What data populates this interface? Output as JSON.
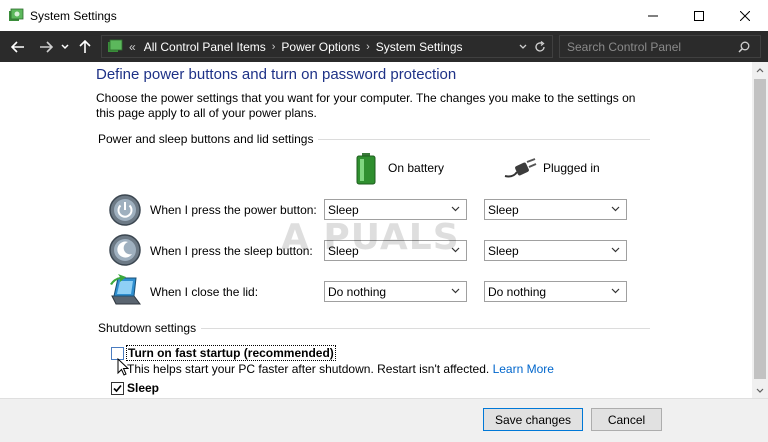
{
  "window": {
    "title": "System Settings",
    "minimize_icon": "minimize-icon",
    "maximize_icon": "maximize-icon",
    "close_icon": "close-icon"
  },
  "address": {
    "overflow": "«",
    "crumbs": [
      "All Control Panel Items",
      "Power Options",
      "System Settings"
    ],
    "search_placeholder": "Search Control Panel"
  },
  "page": {
    "heading": "Define power buttons and turn on password protection",
    "description": "Choose the power settings that you want for your computer. The changes you make to the settings on this page apply to all of your power plans.",
    "group1_label": "Power and sleep buttons and lid settings",
    "col_battery": "On battery",
    "col_plugged": "Plugged in",
    "rows": [
      {
        "label": "When I press the power button:",
        "battery": "Sleep",
        "plugged": "Sleep"
      },
      {
        "label": "When I press the sleep button:",
        "battery": "Sleep",
        "plugged": "Sleep"
      },
      {
        "label": "When I close the lid:",
        "battery": "Do nothing",
        "plugged": "Do nothing"
      }
    ],
    "group2_label": "Shutdown settings",
    "fast_startup_label": "Turn on fast startup (recommended)",
    "fast_startup_checked": false,
    "fast_startup_hint": "This helps start your PC faster after shutdown. Restart isn't affected.",
    "learn_more": "Learn More",
    "sleep_label": "Sleep",
    "sleep_checked": true
  },
  "watermark": "A PUALS",
  "footer": {
    "save": "Save changes",
    "cancel": "Cancel"
  },
  "colors": {
    "heading": "#1e3287",
    "link": "#0066cc",
    "navbar": "#2b2b2b"
  }
}
